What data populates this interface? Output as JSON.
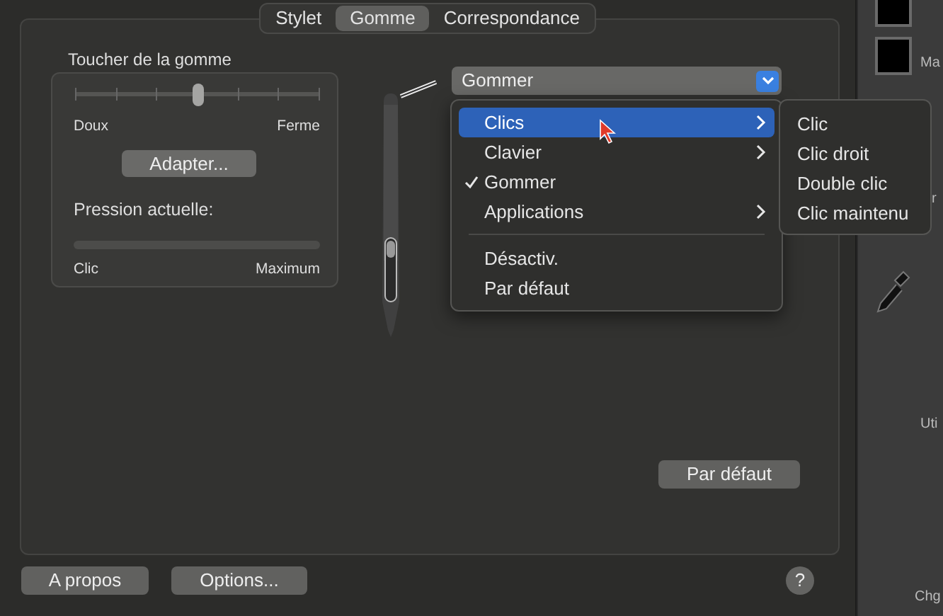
{
  "tabs": [
    {
      "label": "Stylet",
      "selected": false
    },
    {
      "label": "Gomme",
      "selected": true
    },
    {
      "label": "Correspondance",
      "selected": false
    }
  ],
  "feel": {
    "title": "Toucher de la gomme",
    "level": 0.5,
    "min_label": "Doux",
    "max_label": "Ferme",
    "button": "Adapter..."
  },
  "pressure": {
    "label": "Pression actuelle:",
    "level": 0,
    "min_label": "Clic",
    "max_label": "Maximum"
  },
  "function_select": {
    "value": "Gommer"
  },
  "menu": {
    "items": [
      {
        "kind": "item",
        "label": "Clics",
        "selected": true,
        "checked": false,
        "submenu": true
      },
      {
        "kind": "item",
        "label": "Clavier",
        "selected": false,
        "checked": false,
        "submenu": true
      },
      {
        "kind": "item",
        "label": "Gommer",
        "selected": false,
        "checked": true,
        "submenu": false
      },
      {
        "kind": "item",
        "label": "Applications",
        "selected": false,
        "checked": false,
        "submenu": true
      },
      {
        "kind": "separator"
      },
      {
        "kind": "item",
        "label": "Désactiv.",
        "selected": false,
        "checked": false,
        "submenu": false
      },
      {
        "kind": "item",
        "label": "Par défaut",
        "selected": false,
        "checked": false,
        "submenu": false
      }
    ]
  },
  "submenu": {
    "items": [
      "Clic",
      "Clic droit",
      "Double clic",
      "Clic maintenu"
    ]
  },
  "reset_button": "Par défaut",
  "footer": {
    "buttons": [
      "A propos",
      "Options..."
    ],
    "help": "?"
  },
  "background_window": {
    "labels": [
      "Ma",
      "r",
      "Uti",
      "Chg"
    ]
  }
}
